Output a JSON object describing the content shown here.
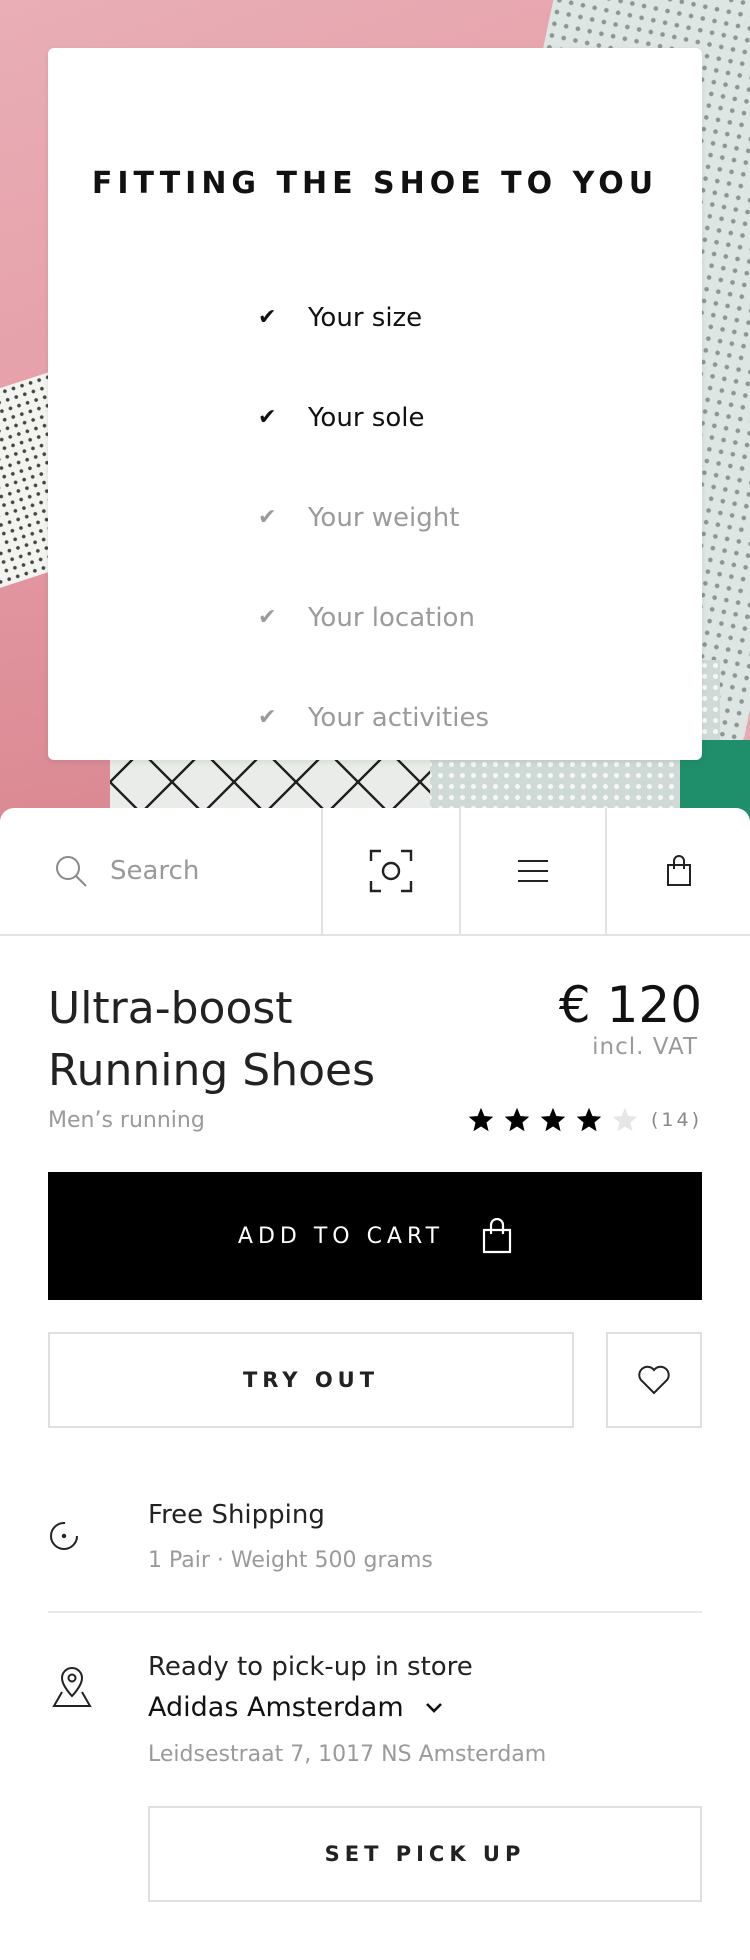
{
  "fitting": {
    "title": "FITTING THE SHOE TO YOU",
    "items": [
      {
        "label": "Your size",
        "done": true
      },
      {
        "label": "Your sole",
        "done": true
      },
      {
        "label": "Your weight",
        "done": false
      },
      {
        "label": "Your location",
        "done": false
      },
      {
        "label": "Your activities",
        "done": false
      }
    ]
  },
  "toolbar": {
    "search_placeholder": "Search",
    "icons": [
      "search-icon",
      "scan-icon",
      "menu-icon",
      "shopping-bag-icon"
    ]
  },
  "product": {
    "name_line1": "Ultra-boost",
    "name_line2": "Running Shoes",
    "price": "€ 120",
    "vat": "incl. VAT",
    "category": "Men’s running",
    "rating": 4,
    "rating_max": 5,
    "review_count": "(14)"
  },
  "actions": {
    "add_to_cart": "ADD TO CART",
    "try_out": "TRY OUT",
    "set_pick_up": "SET PICK UP"
  },
  "shipping": {
    "title": "Free Shipping",
    "detail": "1 Pair · Weight 500 grams"
  },
  "pickup": {
    "title": "Ready to pick-up in store",
    "store": "Adidas Amsterdam",
    "address": "Leidsestraat 7, 1017 NS Amsterdam"
  },
  "colors": {
    "primary_button": "#000000",
    "text_muted": "#9a9a9a",
    "border": "#e0e0e0",
    "star_filled": "#000000",
    "star_empty": "#e6e6e6"
  }
}
